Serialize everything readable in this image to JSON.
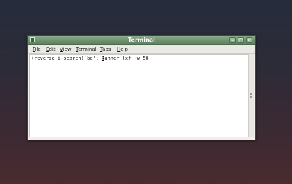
{
  "window": {
    "title": "Terminal"
  },
  "window_controls": {
    "minimize": "‒",
    "maximize": "□",
    "close": "×"
  },
  "menubar": {
    "items": [
      {
        "mnemonic": "F",
        "rest": "ile"
      },
      {
        "mnemonic": "E",
        "rest": "dit"
      },
      {
        "mnemonic": "V",
        "rest": "iew"
      },
      {
        "mnemonic": "T",
        "rest": "erminal"
      },
      {
        "mnemonic": "T",
        "rest": "abs"
      },
      {
        "mnemonic": "H",
        "rest": "elp"
      }
    ]
  },
  "terminal": {
    "prompt": "(reverse-i-search)`ba': ",
    "cursor_char": "b",
    "command_rest": "anner lxf -w 50"
  }
}
